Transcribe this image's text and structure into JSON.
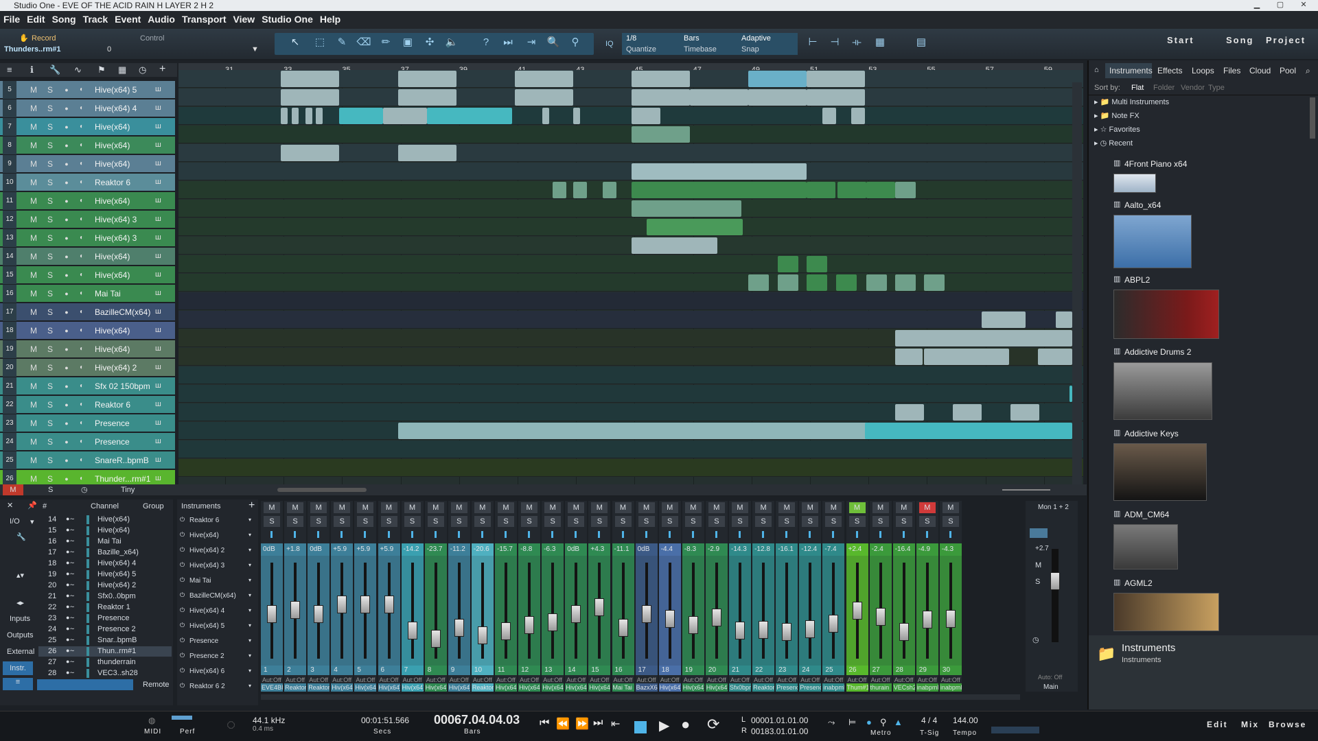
{
  "title": "Studio One - EVE OF THE ACID RAIN H LAYER 2  H 2",
  "menu": [
    "File",
    "Edit",
    "Song",
    "Track",
    "Event",
    "Audio",
    "Transport",
    "View",
    "Studio One",
    "Help"
  ],
  "toolbar": {
    "record": "Record",
    "control": "Control",
    "device": "Thunders..rm#1",
    "device_val": "0",
    "quantize_val": "1/8",
    "quantize_lbl": "Quantize",
    "timebase_val": "Bars",
    "timebase_lbl": "Timebase",
    "snap_val": "Adaptive",
    "snap_lbl": "Snap",
    "iq": "IQ",
    "nav": [
      "Start",
      "Song",
      "Project"
    ]
  },
  "ruler": [
    "31",
    "33",
    "35",
    "37",
    "39",
    "41",
    "43",
    "45",
    "47",
    "49",
    "51",
    "53",
    "55",
    "57",
    "59"
  ],
  "tracks": [
    {
      "n": "5",
      "name": "Hive(x64) 5",
      "color": "#5b7f94"
    },
    {
      "n": "6",
      "name": "Hive(x64) 4",
      "color": "#5b7f94"
    },
    {
      "n": "7",
      "name": "Hive(x64)",
      "color": "#3a8f9c"
    },
    {
      "n": "8",
      "name": "Hive(x64)",
      "color": "#3c8a5a"
    },
    {
      "n": "9",
      "name": "Hive(x64)",
      "color": "#5b7f94"
    },
    {
      "n": "10",
      "name": "Reaktor 6",
      "color": "#5b8d9a"
    },
    {
      "n": "11",
      "name": "Hive(x64)",
      "color": "#3a8a50"
    },
    {
      "n": "12",
      "name": "Hive(x64) 3",
      "color": "#3a8a50"
    },
    {
      "n": "13",
      "name": "Hive(x64) 3",
      "color": "#3a8a50"
    },
    {
      "n": "14",
      "name": "Hive(x64)",
      "color": "#4f7f6c"
    },
    {
      "n": "15",
      "name": "Hive(x64)",
      "color": "#3a8a50"
    },
    {
      "n": "16",
      "name": "Mai Tai",
      "color": "#3a8a50"
    },
    {
      "n": "17",
      "name": "BazilleCM(x64)",
      "color": "#3b4f6e"
    },
    {
      "n": "18",
      "name": "Hive(x64)",
      "color": "#4a5f8a"
    },
    {
      "n": "19",
      "name": "Hive(x64)",
      "color": "#5c7a64"
    },
    {
      "n": "20",
      "name": "Hive(x64) 2",
      "color": "#5c7a64"
    },
    {
      "n": "21",
      "name": "Sfx 02 150bpm",
      "color": "#3a8d8a"
    },
    {
      "n": "22",
      "name": "Reaktor 6",
      "color": "#3a8d8a"
    },
    {
      "n": "23",
      "name": "Presence",
      "color": "#3a8d8a"
    },
    {
      "n": "24",
      "name": "Presence",
      "color": "#3a8d8a"
    },
    {
      "n": "25",
      "name": "SnareR..bpmB",
      "color": "#3a8d8a"
    },
    {
      "n": "26",
      "name": "Thunder...rm#1",
      "color": "#59b52e"
    }
  ],
  "track_buttons": {
    "m": "M",
    "s": "S"
  },
  "arr_footer": {
    "zoom": "Tiny",
    "m": "M",
    "s": "S"
  },
  "browser": {
    "tabs": [
      "Instruments",
      "Effects",
      "Loops",
      "Files",
      "Cloud",
      "Pool"
    ],
    "sort_by": "Sort by:",
    "sort": [
      "Flat",
      "Folder",
      "Vendor",
      "Type"
    ],
    "folders": [
      "Multi Instruments",
      "Note FX",
      "Favorites",
      "Recent"
    ],
    "instruments": [
      "4Front Piano x64",
      "Aalto_x64",
      "ABPL2",
      "Addictive Drums 2",
      "Addictive Keys",
      "ADM_CM64",
      "AGML2"
    ],
    "footer_title": "Instruments",
    "footer_sub": "Instruments"
  },
  "mixer": {
    "channel_hdr": "Channel",
    "group_hdr": "Group",
    "instruments_hdr": "Instruments",
    "side": [
      "I/O",
      "Inputs",
      "Outputs",
      "External",
      "Instr."
    ],
    "remote": "Remote",
    "channels": [
      {
        "n": "14",
        "name": "Hive(x64)"
      },
      {
        "n": "15",
        "name": "Hive(x64)"
      },
      {
        "n": "16",
        "name": "Mai Tai"
      },
      {
        "n": "17",
        "name": "Bazille_x64)"
      },
      {
        "n": "18",
        "name": "Hive(x64) 4"
      },
      {
        "n": "19",
        "name": "Hive(x64) 5"
      },
      {
        "n": "20",
        "name": "Hive(x64) 2"
      },
      {
        "n": "21",
        "name": "Sfx0..0bpm"
      },
      {
        "n": "22",
        "name": "Reaktor 1"
      },
      {
        "n": "23",
        "name": "Presence"
      },
      {
        "n": "24",
        "name": "Presence 2"
      },
      {
        "n": "25",
        "name": "Snar..bpmB"
      },
      {
        "n": "26",
        "name": "Thun..rm#1"
      },
      {
        "n": "27",
        "name": "thunderrain"
      },
      {
        "n": "28",
        "name": "VEC3..sh28"
      }
    ],
    "instrs": [
      "Reaktor 6",
      "Hive(x64)",
      "Hive(x64) 2",
      "Hive(x64) 3",
      "Mai Tai",
      "BazilleCM(x64)",
      "Hive(x64) 4",
      "Hive(x64) 5",
      "Presence",
      "Presence 2",
      "Hive(x64) 6",
      "Reaktor 6 2"
    ],
    "strips": [
      {
        "db": "0dB",
        "n": "1",
        "lvl": 0.5,
        "c": "#3d7f99",
        "nm": "EVE4BIT"
      },
      {
        "db": "+1.8",
        "n": "2",
        "lvl": 0.55,
        "c": "#3d7f99",
        "nm": "Reaktor1"
      },
      {
        "db": "0dB",
        "n": "3",
        "lvl": 0.5,
        "c": "#3d7f99",
        "nm": "Reaktor6"
      },
      {
        "db": "+5.9",
        "n": "4",
        "lvl": 0.62,
        "c": "#3d7f99",
        "nm": "Hiv(x64)"
      },
      {
        "db": "+5.9",
        "n": "5",
        "lvl": 0.62,
        "c": "#3d7f99",
        "nm": "Hiv(x64)5"
      },
      {
        "db": "+5.9",
        "n": "6",
        "lvl": 0.62,
        "c": "#3d7f99",
        "nm": "Hiv(x64)4"
      },
      {
        "db": "-14.2",
        "n": "7",
        "lvl": 0.3,
        "c": "#3aa0b0",
        "nm": "Hiv(x64)2"
      },
      {
        "db": "-23.7",
        "n": "8",
        "lvl": 0.2,
        "c": "#2f8a52",
        "nm": "Hiv(x64)"
      },
      {
        "db": "-11.2",
        "n": "9",
        "lvl": 0.33,
        "c": "#3d7f99",
        "nm": "Hiv(x64)7"
      },
      {
        "db": "-20.6",
        "n": "10",
        "lvl": 0.24,
        "c": "#4fb0c0",
        "nm": "Reaktor1"
      },
      {
        "db": "-15.7",
        "n": "11",
        "lvl": 0.29,
        "c": "#2f8a52",
        "nm": "Hiv(x64)3"
      },
      {
        "db": "-8.8",
        "n": "12",
        "lvl": 0.37,
        "c": "#2f8a52",
        "nm": "Hiv(x64)3"
      },
      {
        "db": "-6.3",
        "n": "13",
        "lvl": 0.4,
        "c": "#2f8a52",
        "nm": "Hiv(x64)3"
      },
      {
        "db": "0dB",
        "n": "14",
        "lvl": 0.5,
        "c": "#2f8a52",
        "nm": "Hiv(x64)"
      },
      {
        "db": "+4.3",
        "n": "15",
        "lvl": 0.58,
        "c": "#2f8a52",
        "nm": "Hiv(x64)"
      },
      {
        "db": "-11.1",
        "n": "16",
        "lvl": 0.33,
        "c": "#2f8a52",
        "nm": "Mai Tai"
      },
      {
        "db": "0dB",
        "n": "17",
        "lvl": 0.5,
        "c": "#3c5a86",
        "nm": "BazxX64"
      },
      {
        "db": "-4.4",
        "n": "18",
        "lvl": 0.44,
        "c": "#4a6fa8",
        "nm": "Hiv(x64)4"
      },
      {
        "db": "-8.3",
        "n": "19",
        "lvl": 0.37,
        "c": "#2f8a52",
        "nm": "Hiv(x64)5"
      },
      {
        "db": "-2.9",
        "n": "20",
        "lvl": 0.46,
        "c": "#2f8a52",
        "nm": "Hiv(x64)2"
      },
      {
        "db": "-14.3",
        "n": "21",
        "lvl": 0.3,
        "c": "#2f8a8a",
        "nm": "Sfx0bpm"
      },
      {
        "db": "-12.8",
        "n": "22",
        "lvl": 0.31,
        "c": "#2f8a8a",
        "nm": "Reaktor1"
      },
      {
        "db": "-16.1",
        "n": "23",
        "lvl": 0.28,
        "c": "#2f8a8a",
        "nm": "Presence"
      },
      {
        "db": "-12.4",
        "n": "24",
        "lvl": 0.32,
        "c": "#2f8a8a",
        "nm": "Presence2"
      },
      {
        "db": "-7.4",
        "n": "25",
        "lvl": 0.38,
        "c": "#2f8a8a",
        "nm": "inabpml"
      },
      {
        "db": "+2.4",
        "n": "26",
        "lvl": 0.54,
        "c": "#58b82c",
        "nm": "Thum#1"
      },
      {
        "db": "-2.4",
        "n": "27",
        "lvl": 0.47,
        "c": "#3b9a3b",
        "nm": "thurain"
      },
      {
        "db": "-16.4",
        "n": "28",
        "lvl": 0.28,
        "c": "#3b9a3b",
        "nm": "VECsh2"
      },
      {
        "db": "-4.9",
        "n": "29",
        "lvl": 0.43,
        "c": "#3b9a3b",
        "nm": "inabpml"
      },
      {
        "db": "-4.3",
        "n": "30",
        "lvl": 0.44,
        "c": "#3b9a3b",
        "nm": "inabpml"
      }
    ],
    "main": {
      "label": "Mon 1 + 2",
      "db": "+2.7",
      "auto": "Auto: Off",
      "name": "Main"
    }
  },
  "transport": {
    "midi": "MIDI",
    "perf": "Perf",
    "rate": "44.1 kHz",
    "latency": "0.4 ms",
    "secs": "00:01:51.566",
    "secs_lbl": "Secs",
    "bars": "00067.04.04.03",
    "bars_lbl": "Bars",
    "L": "00001.01.01.00",
    "R": "00183.01.01.00",
    "metro": "Metro",
    "tsig": "4 / 4",
    "tsig_lbl": "T-Sig",
    "tempo": "144.00",
    "tempo_lbl": "Tempo",
    "views": [
      "Edit",
      "Mix",
      "Browse"
    ]
  }
}
